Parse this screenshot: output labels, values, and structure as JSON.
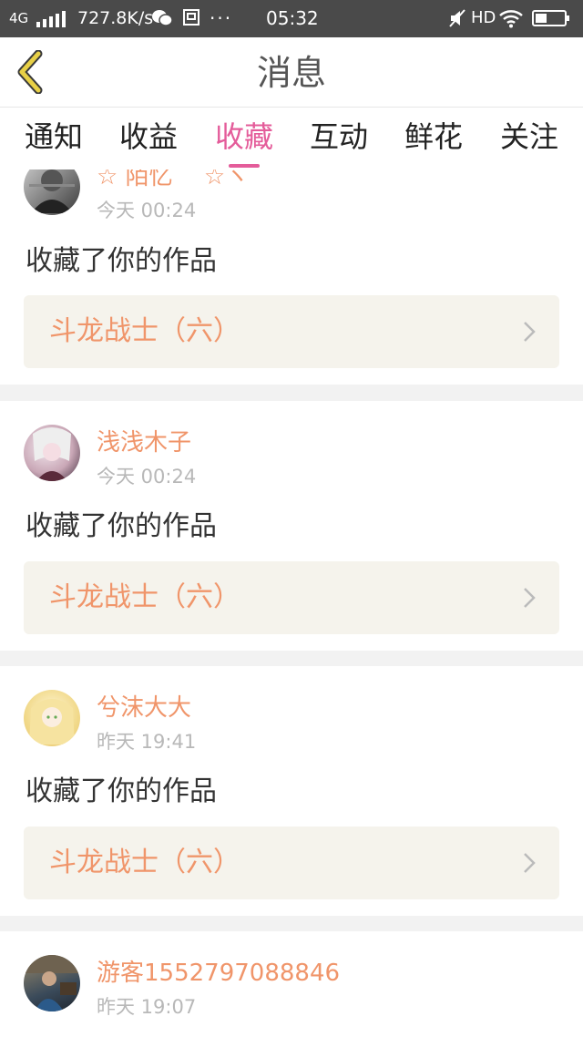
{
  "status_bar": {
    "network": "4G",
    "speed": "727.8K/s",
    "dots": "···",
    "time": "05:32",
    "hd": "HD"
  },
  "header": {
    "title": "消息"
  },
  "tabs": [
    {
      "label": "通知"
    },
    {
      "label": "收益"
    },
    {
      "label": "收藏",
      "active": true
    },
    {
      "label": "互动"
    },
    {
      "label": "鲜花"
    },
    {
      "label": "关注"
    }
  ],
  "messages": [
    {
      "username": "☆ 陌忆 ゛☆ヽ",
      "time": "今天 00:24",
      "action": "收藏了你的作品",
      "work": "斗龙战士（六）"
    },
    {
      "username": "浅浅木子",
      "time": "今天 00:24",
      "action": "收藏了你的作品",
      "work": "斗龙战士（六）"
    },
    {
      "username": "兮沫大大",
      "time": "昨天 19:41",
      "action": "收藏了你的作品",
      "work": "斗龙战士（六）"
    },
    {
      "username": "游客1552797088846",
      "time": "昨天 19:07"
    }
  ],
  "colors": {
    "accent": "#e45c9a",
    "username": "#f0956a",
    "status_bar": "#4a4a4a",
    "back_arrow": "#e8d046"
  }
}
